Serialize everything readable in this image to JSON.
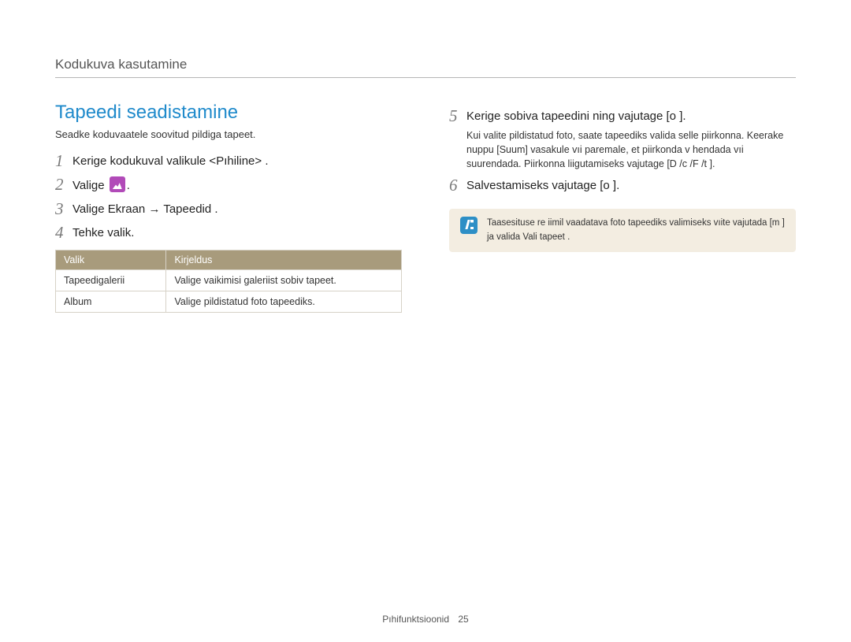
{
  "header": {
    "breadcrumb": "Kodukuva kasutamine"
  },
  "section_title": "Tapeedi seadistamine",
  "intro": "Seadke koduvaatele soovitud pildiga tapeet.",
  "steps_left": {
    "s1": "Kerige kodukuval valikule <Pıhiline> .",
    "s2_prefix": "Valige ",
    "s2_suffix": ".",
    "s3": "Valige Ekraan  →  Tapeedid .",
    "s4": "Tehke valik."
  },
  "table": {
    "head_option": "Valik",
    "head_desc": "Kirjeldus",
    "rows": [
      {
        "option": "Tapeedigalerii",
        "desc": "Valige vaikimisi galeriist sobiv tapeet."
      },
      {
        "option": "Album",
        "desc": "Valige pildistatud foto tapeediks."
      }
    ]
  },
  "steps_right": {
    "s5": "Kerige sobiva tapeedini ning vajutage [o   ].",
    "s5_sub": "Kui valite pildistatud foto, saate tapeediks valida selle piirkonna. Keerake nuppu [Suum] vasakule vıi paremale, et piirkonda v hendada vıi suurendada. Piirkonna liigutamiseks vajutage [D    /c  /F /t   ].",
    "s6": "Salvestamiseks vajutage [o   ]."
  },
  "note": "Taasesituse re iimil vaadatava foto tapeediks valimiseks vıite vajutada [m      ] ja valida Vali tapeet .",
  "footer": {
    "label": "Pıhifunktsioonid",
    "page": "25"
  }
}
